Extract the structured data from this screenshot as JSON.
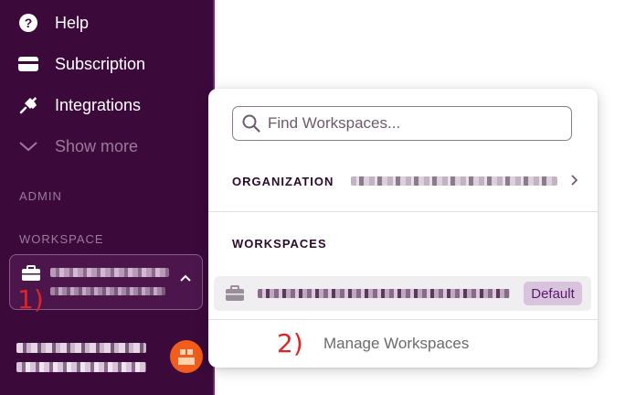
{
  "sidebar": {
    "nav": [
      {
        "label": "Help",
        "icon": "help-circle-icon"
      },
      {
        "label": "Subscription",
        "icon": "credit-card-icon"
      },
      {
        "label": "Integrations",
        "icon": "plug-icon"
      },
      {
        "label": "Show more",
        "icon": "chevron-down-icon"
      }
    ],
    "admin_label": "ADMIN",
    "workspace_label": "WORKSPACE"
  },
  "annotations": {
    "step1": "1)",
    "step2": "2)"
  },
  "dropdown": {
    "search_placeholder": "Find Workspaces...",
    "organization_label": "ORGANIZATION",
    "workspaces_label": "WORKSPACES",
    "default_badge": "Default",
    "manage_label": "Manage Workspaces"
  },
  "colors": {
    "sidebar_bg": "#3b0a3b",
    "accent": "#5a1a6a",
    "badge_bg": "#d9c4de",
    "annotation_red": "#e02424",
    "avatar": "#f25c1c"
  }
}
